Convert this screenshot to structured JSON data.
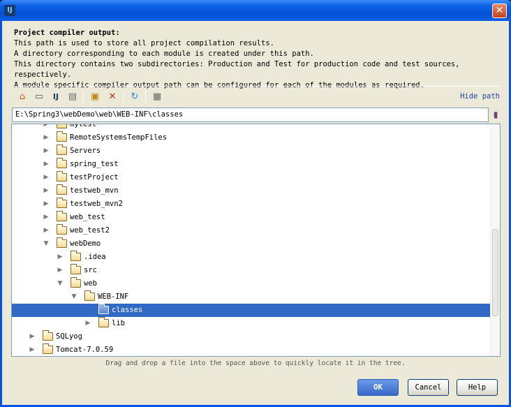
{
  "window": {
    "app_icon_label": "IJ",
    "close_glyph": "✕"
  },
  "description": {
    "heading": "Project compiler output:",
    "lines": [
      "This path is used to store all project compilation results.",
      "A directory corresponding to each module is created under this path.",
      "This directory contains two subdirectories: Production and Test for production code and test sources, respectively.",
      "A module specific compiler output path can be configured for each of the modules as required."
    ]
  },
  "toolbar": {
    "icons": [
      "home-icon",
      "desktop-icon",
      "project-icon",
      "module-icon",
      "new-folder-icon",
      "delete-icon",
      "refresh-icon",
      "show-hidden-icon"
    ],
    "hide_path_label": "Hide path"
  },
  "path": {
    "value": "E:\\Spring3\\webDemo\\web\\WEB-INF\\classes",
    "browse_icon": "history-icon"
  },
  "tree": {
    "rows": [
      {
        "label": "mytest",
        "expanded": false
      },
      {
        "label": "RemoteSystemsTempFiles",
        "expanded": false
      },
      {
        "label": "Servers",
        "expanded": false
      },
      {
        "label": "spring_test",
        "expanded": false
      },
      {
        "label": "testProject",
        "expanded": false
      },
      {
        "label": "testweb_mvn",
        "expanded": false
      },
      {
        "label": "testweb_mvn2",
        "expanded": false
      },
      {
        "label": "web_test",
        "expanded": false
      },
      {
        "label": "web_test2",
        "expanded": false
      },
      {
        "label": "webDemo",
        "expanded": true
      },
      {
        "label": ".idea",
        "expanded": false
      },
      {
        "label": "src",
        "expanded": false
      },
      {
        "label": "web",
        "expanded": true
      },
      {
        "label": "WEB-INF",
        "expanded": true
      },
      {
        "label": "classes",
        "expanded": false,
        "selected": true
      },
      {
        "label": "lib",
        "expanded": false
      },
      {
        "label": "SQLyog",
        "expanded": false
      },
      {
        "label": "Tomcat-7.0.59",
        "expanded": false
      }
    ]
  },
  "hint": "Drag and drop a file into the space above to quickly locate it in the tree.",
  "buttons": {
    "ok": "OK",
    "cancel": "Cancel",
    "help": "Help"
  },
  "colors": {
    "selection": "#316ac5",
    "link": "#1a44a8",
    "titlebar": "#0054e3"
  }
}
